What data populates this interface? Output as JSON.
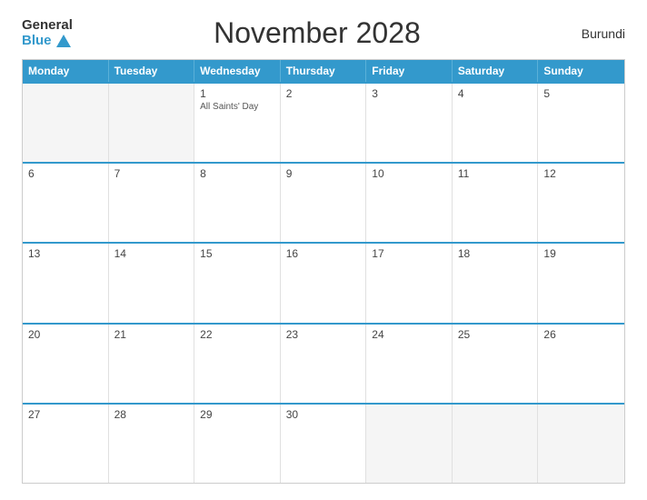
{
  "header": {
    "logo_general": "General",
    "logo_blue": "Blue",
    "title": "November 2028",
    "country": "Burundi"
  },
  "days_of_week": [
    "Monday",
    "Tuesday",
    "Wednesday",
    "Thursday",
    "Friday",
    "Saturday",
    "Sunday"
  ],
  "weeks": [
    [
      {
        "num": "",
        "event": "",
        "empty": true
      },
      {
        "num": "",
        "event": "",
        "empty": true
      },
      {
        "num": "1",
        "event": "All Saints' Day",
        "empty": false
      },
      {
        "num": "2",
        "event": "",
        "empty": false
      },
      {
        "num": "3",
        "event": "",
        "empty": false
      },
      {
        "num": "4",
        "event": "",
        "empty": false
      },
      {
        "num": "5",
        "event": "",
        "empty": false
      }
    ],
    [
      {
        "num": "6",
        "event": "",
        "empty": false
      },
      {
        "num": "7",
        "event": "",
        "empty": false
      },
      {
        "num": "8",
        "event": "",
        "empty": false
      },
      {
        "num": "9",
        "event": "",
        "empty": false
      },
      {
        "num": "10",
        "event": "",
        "empty": false
      },
      {
        "num": "11",
        "event": "",
        "empty": false
      },
      {
        "num": "12",
        "event": "",
        "empty": false
      }
    ],
    [
      {
        "num": "13",
        "event": "",
        "empty": false
      },
      {
        "num": "14",
        "event": "",
        "empty": false
      },
      {
        "num": "15",
        "event": "",
        "empty": false
      },
      {
        "num": "16",
        "event": "",
        "empty": false
      },
      {
        "num": "17",
        "event": "",
        "empty": false
      },
      {
        "num": "18",
        "event": "",
        "empty": false
      },
      {
        "num": "19",
        "event": "",
        "empty": false
      }
    ],
    [
      {
        "num": "20",
        "event": "",
        "empty": false
      },
      {
        "num": "21",
        "event": "",
        "empty": false
      },
      {
        "num": "22",
        "event": "",
        "empty": false
      },
      {
        "num": "23",
        "event": "",
        "empty": false
      },
      {
        "num": "24",
        "event": "",
        "empty": false
      },
      {
        "num": "25",
        "event": "",
        "empty": false
      },
      {
        "num": "26",
        "event": "",
        "empty": false
      }
    ],
    [
      {
        "num": "27",
        "event": "",
        "empty": false
      },
      {
        "num": "28",
        "event": "",
        "empty": false
      },
      {
        "num": "29",
        "event": "",
        "empty": false
      },
      {
        "num": "30",
        "event": "",
        "empty": false
      },
      {
        "num": "",
        "event": "",
        "empty": true
      },
      {
        "num": "",
        "event": "",
        "empty": true
      },
      {
        "num": "",
        "event": "",
        "empty": true
      }
    ]
  ]
}
